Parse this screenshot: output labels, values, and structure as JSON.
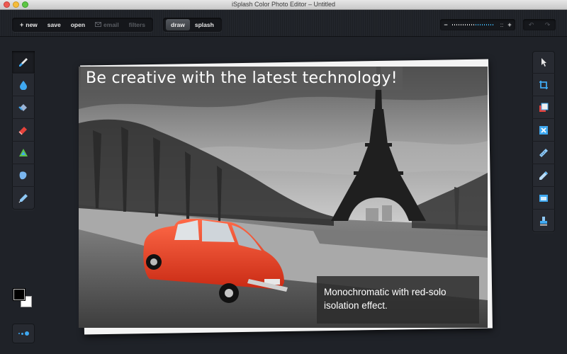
{
  "window": {
    "title": "iSplash Color Photo Editor – Untitled"
  },
  "toolbar": {
    "new_label": "new",
    "new_glyph": "+",
    "save_label": "save",
    "open_label": "open",
    "email_label": "email",
    "filters_label": "filters",
    "draw_label": "draw",
    "splash_label": "splash",
    "zoom_minus": "−",
    "zoom_plus": "+",
    "zoom_fit": "::",
    "zoom_level": 0.45,
    "undo_glyph": "↶",
    "redo_glyph": "↷"
  },
  "left_tools": [
    "brush-icon",
    "drop-icon",
    "fill-icon",
    "eraser-icon",
    "triangle-icon",
    "blob-icon",
    "dropper-icon"
  ],
  "right_tools": [
    "pointer-icon",
    "crop-icon",
    "layers-icon",
    "cancel-icon",
    "ruler-icon",
    "pencil-icon",
    "window-icon",
    "stamp-icon"
  ],
  "colors": {
    "foreground": "#000000",
    "background": "#ffffff",
    "accent": "#3fa8f0",
    "car_red": "#e83a22"
  },
  "canvas": {
    "headline": "Be creative with the latest technology!",
    "caption": "Monochromatic with red-solo isolation effect."
  }
}
